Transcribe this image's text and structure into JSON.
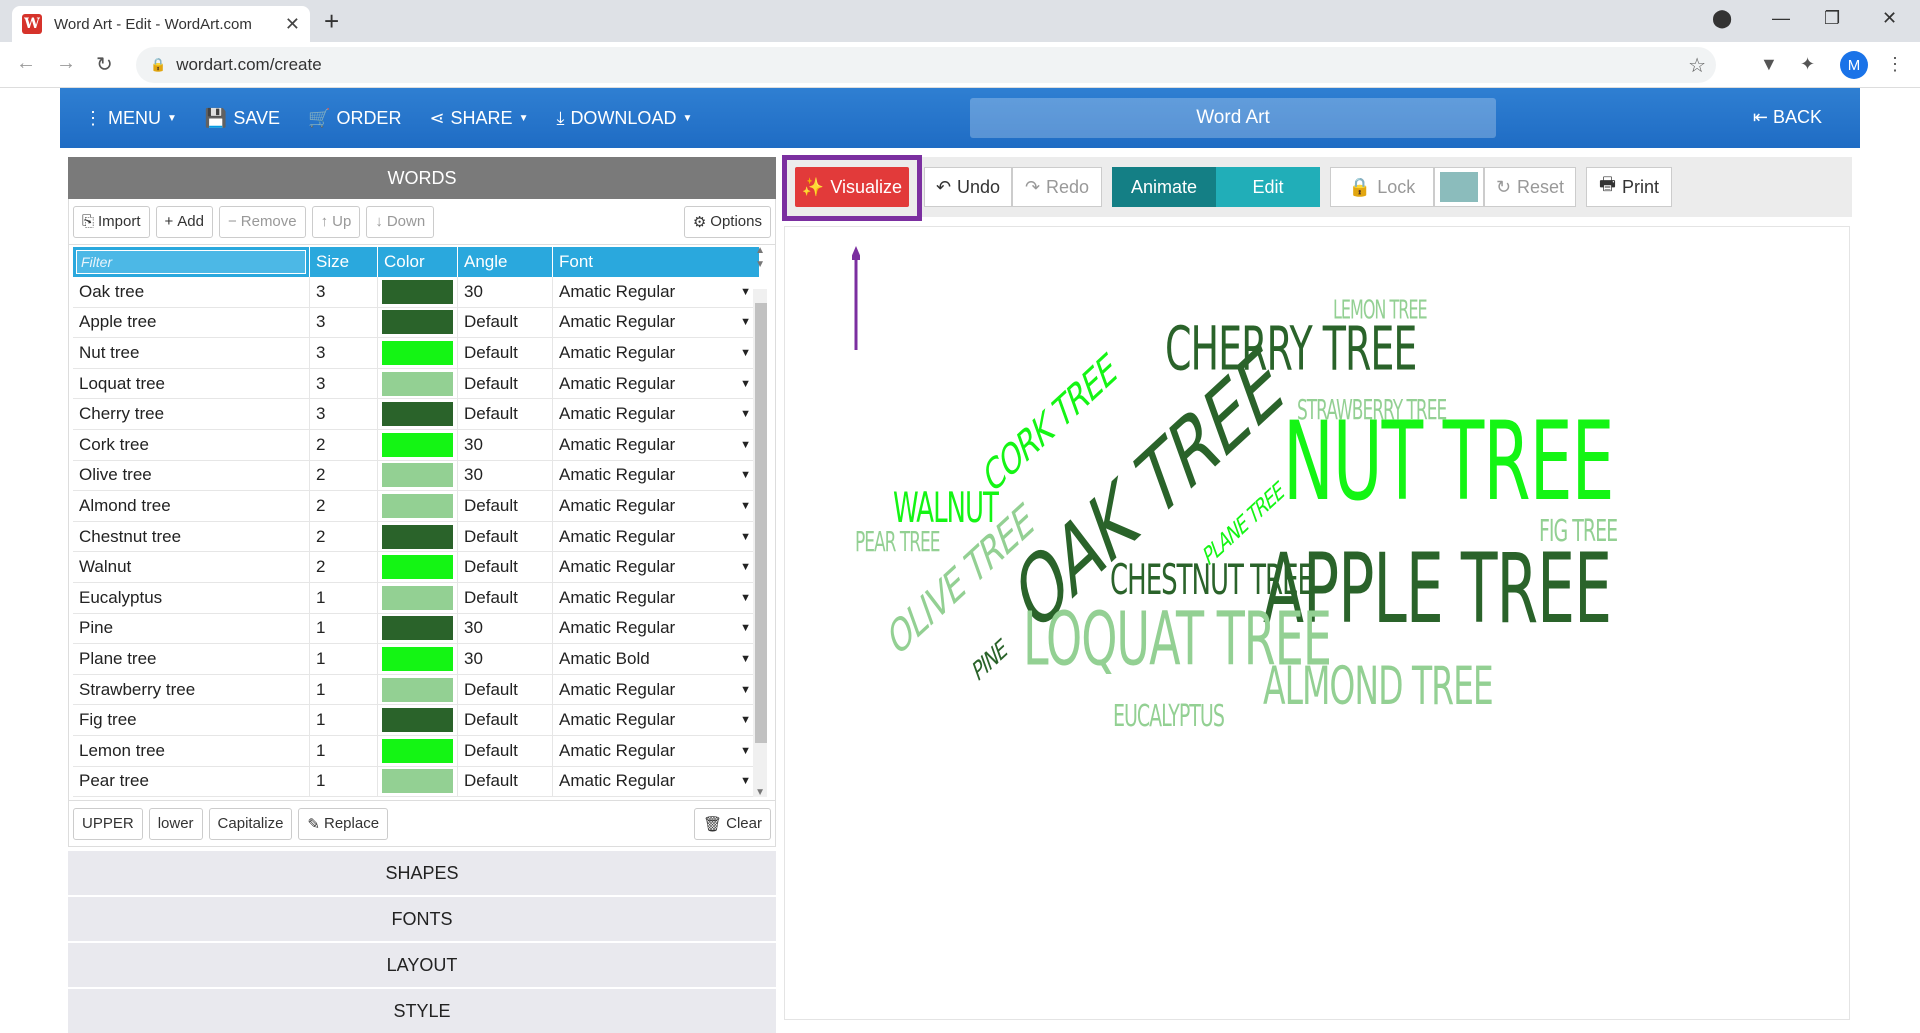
{
  "browser": {
    "tab_title": "Word Art - Edit - WordArt.com",
    "url": "wordart.com/create",
    "profile_initial": "M",
    "favicon": "W"
  },
  "header": {
    "menu": "MENU",
    "save": "SAVE",
    "order": "ORDER",
    "share": "SHARE",
    "download": "DOWNLOAD",
    "title": "Word Art",
    "back": "BACK"
  },
  "words_panel": {
    "title": "WORDS",
    "buttons": {
      "import": "Import",
      "add": "Add",
      "remove": "Remove",
      "up": "Up",
      "down": "Down",
      "options": "Options"
    },
    "columns": {
      "filter_placeholder": "Filter",
      "size": "Size",
      "color": "Color",
      "angle": "Angle",
      "font": "Font"
    },
    "rows": [
      {
        "word": "Oak tree",
        "size": "3",
        "color": "#2a632a",
        "angle": "30",
        "font": "Amatic Regular"
      },
      {
        "word": "Apple tree",
        "size": "3",
        "color": "#2a632a",
        "angle": "Default",
        "font": "Amatic Regular"
      },
      {
        "word": "Nut tree",
        "size": "3",
        "color": "#14f514",
        "angle": "Default",
        "font": "Amatic Regular"
      },
      {
        "word": "Loquat tree",
        "size": "3",
        "color": "#93d093",
        "angle": "Default",
        "font": "Amatic Regular"
      },
      {
        "word": "Cherry tree",
        "size": "3",
        "color": "#2a632a",
        "angle": "Default",
        "font": "Amatic Regular"
      },
      {
        "word": "Cork tree",
        "size": "2",
        "color": "#14f514",
        "angle": "30",
        "font": "Amatic Regular"
      },
      {
        "word": "Olive tree",
        "size": "2",
        "color": "#93d093",
        "angle": "30",
        "font": "Amatic Regular"
      },
      {
        "word": "Almond tree",
        "size": "2",
        "color": "#93d093",
        "angle": "Default",
        "font": "Amatic Regular"
      },
      {
        "word": "Chestnut tree",
        "size": "2",
        "color": "#2a632a",
        "angle": "Default",
        "font": "Amatic Regular"
      },
      {
        "word": "Walnut",
        "size": "2",
        "color": "#14f514",
        "angle": "Default",
        "font": "Amatic Regular"
      },
      {
        "word": "Eucalyptus",
        "size": "1",
        "color": "#93d093",
        "angle": "Default",
        "font": "Amatic Regular"
      },
      {
        "word": "Pine",
        "size": "1",
        "color": "#2a632a",
        "angle": "30",
        "font": "Amatic Regular"
      },
      {
        "word": "Plane tree",
        "size": "1",
        "color": "#14f514",
        "angle": "30",
        "font": "Amatic Bold"
      },
      {
        "word": "Strawberry tree",
        "size": "1",
        "color": "#93d093",
        "angle": "Default",
        "font": "Amatic Regular"
      },
      {
        "word": "Fig tree",
        "size": "1",
        "color": "#2a632a",
        "angle": "Default",
        "font": "Amatic Regular"
      },
      {
        "word": "Lemon tree",
        "size": "1",
        "color": "#14f514",
        "angle": "Default",
        "font": "Amatic Regular"
      },
      {
        "word": "Pear tree",
        "size": "1",
        "color": "#93d093",
        "angle": "Default",
        "font": "Amatic Regular"
      }
    ],
    "footer": {
      "upper": "UPPER",
      "lower": "lower",
      "capitalize": "Capitalize",
      "replace": "Replace",
      "clear": "Clear"
    }
  },
  "sections": [
    "SHAPES",
    "FONTS",
    "LAYOUT",
    "STYLE"
  ],
  "toolbar": {
    "visualize": "Visualize",
    "undo": "Undo",
    "redo": "Redo",
    "animate": "Animate",
    "edit": "Edit",
    "lock": "Lock",
    "reset": "Reset",
    "print": "Print",
    "bg_color": "#8bbcbc"
  },
  "colors": {
    "dark_green": "#2a632a",
    "bright_green": "#14f514",
    "light_green": "#93d093",
    "accent_blue": "#2aa8dd",
    "visualize_red": "#e23a3a",
    "annotation_purple": "#7b2fa0"
  },
  "word_cloud": [
    {
      "text": "LEMON TREE",
      "color": "#93d093"
    },
    {
      "text": "CHERRY TREE",
      "color": "#2a632a"
    },
    {
      "text": "STRAWBERRY TREE",
      "color": "#93d093"
    },
    {
      "text": "CORK TREE",
      "color": "#14f514"
    },
    {
      "text": "OAK TREE",
      "color": "#2a632a"
    },
    {
      "text": "NUT TREE",
      "color": "#14f514"
    },
    {
      "text": "WALNUT",
      "color": "#14f514"
    },
    {
      "text": "PLANE TREE",
      "color": "#14f514"
    },
    {
      "text": "FIG TREE",
      "color": "#93d093"
    },
    {
      "text": "PEAR TREE",
      "color": "#93d093"
    },
    {
      "text": "OLIVE TREE",
      "color": "#93d093"
    },
    {
      "text": "CHESTNUT TREE",
      "color": "#2a632a"
    },
    {
      "text": "APPLE TREE",
      "color": "#2a632a"
    },
    {
      "text": "PINE",
      "color": "#2a632a"
    },
    {
      "text": "LOQUAT TREE",
      "color": "#93d093"
    },
    {
      "text": "ALMOND TREE",
      "color": "#93d093"
    },
    {
      "text": "EUCALYPTUS",
      "color": "#93d093"
    }
  ]
}
